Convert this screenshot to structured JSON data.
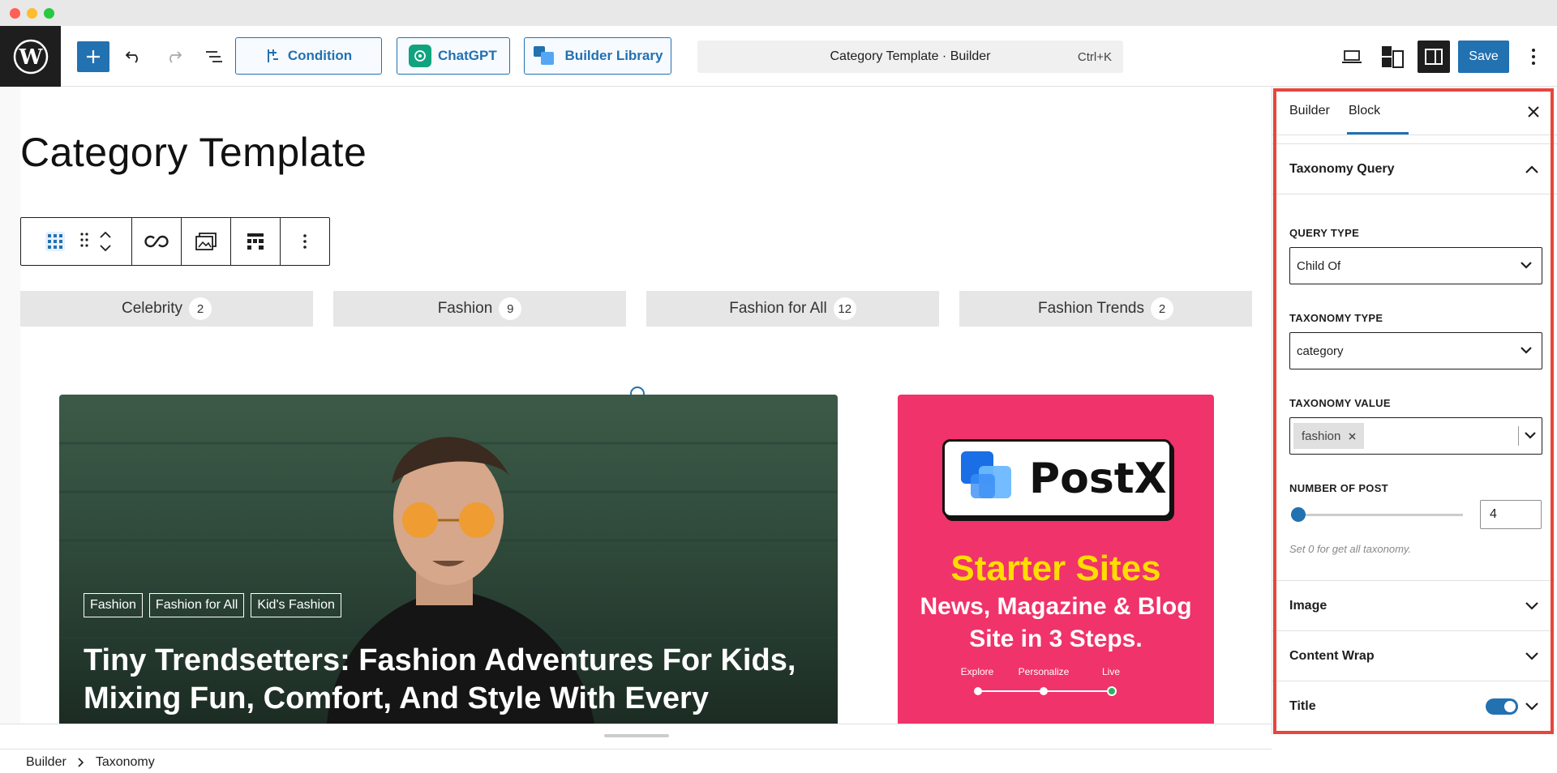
{
  "toolbar": {
    "condition_label": "Condition",
    "chatgpt_label": "ChatGPT",
    "library_label": "Builder Library",
    "command_title": "Category Template · Builder",
    "command_shortcut": "Ctrl+K",
    "save_label": "Save"
  },
  "canvas": {
    "page_title": "Category Template",
    "categories": [
      {
        "name": "Celebrity",
        "count": "2"
      },
      {
        "name": "Fashion",
        "count": "9"
      },
      {
        "name": "Fashion for All",
        "count": "12"
      },
      {
        "name": "Fashion Trends",
        "count": "2"
      }
    ],
    "hero": {
      "tags": [
        "Fashion",
        "Fashion for All",
        "Kid's Fashion"
      ],
      "title": "Tiny Trendsetters: Fashion Adventures For Kids, Mixing Fun, Comfort, And Style With Every"
    },
    "promo": {
      "brand": "PostX",
      "headline": "Starter Sites",
      "sub1": "News, Magazine & Blog",
      "sub2": "Site in 3 Steps.",
      "steps": [
        "Explore",
        "Personalize",
        "Live"
      ]
    }
  },
  "breadcrumb": {
    "items": [
      "Builder",
      "Taxonomy"
    ]
  },
  "panel": {
    "tabs": [
      "Builder",
      "Block"
    ],
    "active_tab": "Block",
    "section_title": "Taxonomy Query",
    "query_type_label": "QUERY TYPE",
    "query_type_value": "Child Of",
    "taxonomy_type_label": "TAXONOMY TYPE",
    "taxonomy_type_value": "category",
    "taxonomy_value_label": "TAXONOMY VALUE",
    "taxonomy_value_token": "fashion",
    "number_label": "NUMBER OF POST",
    "number_value": "4",
    "number_slider_fraction": 0,
    "help_text": "Set 0 for get all taxonomy.",
    "sections": [
      "Image",
      "Content Wrap",
      "Title"
    ],
    "title_toggle_on": true
  },
  "colors": {
    "accent": "#2271b1",
    "highlight": "#e8453c",
    "promo_bg": "#f0336a",
    "promo_headline": "#ffdd00"
  }
}
